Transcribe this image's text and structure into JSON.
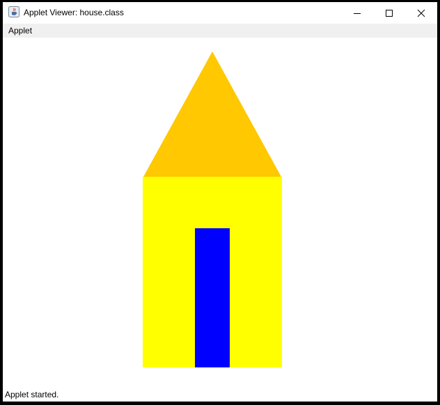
{
  "window": {
    "title": "Applet Viewer: house.class"
  },
  "menubar": {
    "items": [
      {
        "label": "Applet"
      }
    ]
  },
  "drawing": {
    "roof_color": "#ffc800",
    "wall_color": "#ffff00",
    "door_color": "#0000ff"
  },
  "status": {
    "text": "Applet started."
  }
}
